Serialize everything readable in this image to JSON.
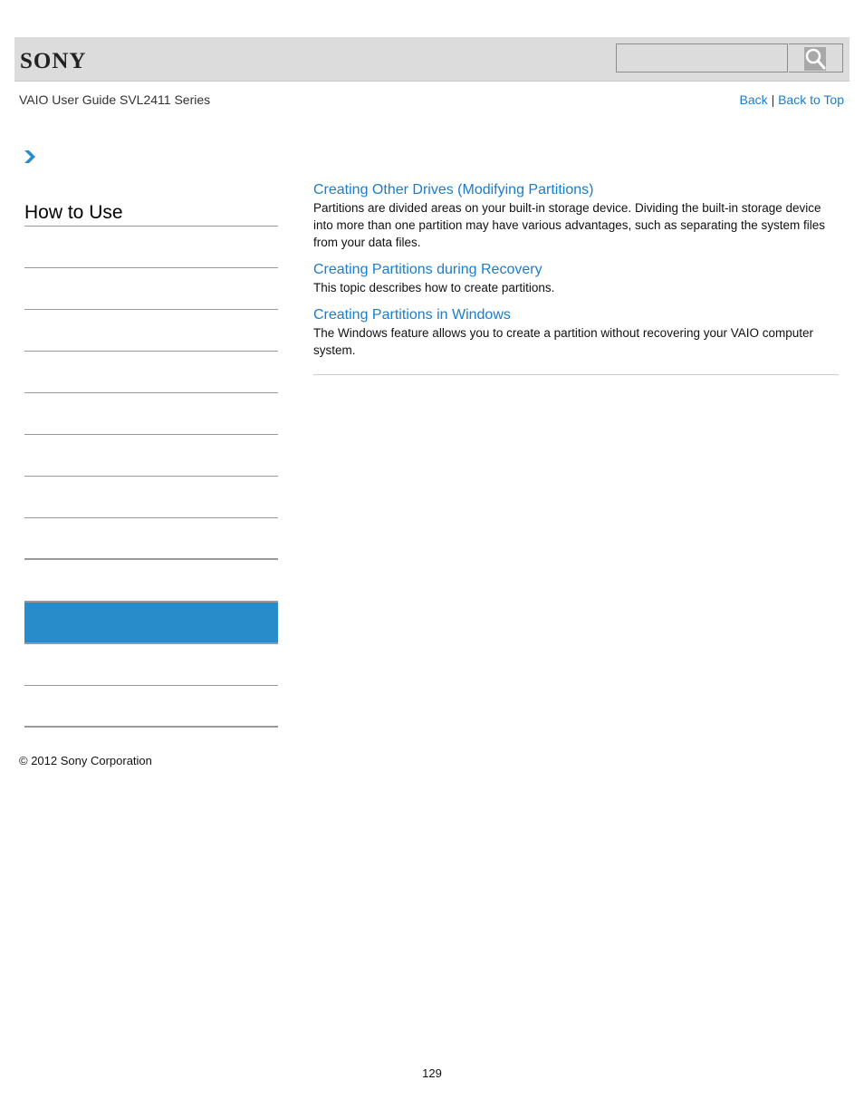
{
  "header": {
    "logo": "SONY",
    "search": {
      "placeholder": "",
      "value": ""
    },
    "search_button_icon": "search-icon"
  },
  "guide_title": "VAIO User Guide SVL2411 Series",
  "top_links": {
    "back": "Back",
    "separator": "|",
    "back_to_top": "Back to Top"
  },
  "breadcrumb_icon": "chevron-right-icon",
  "sidebar": {
    "title": "How to Use",
    "items": [
      {
        "label": "",
        "active": false
      },
      {
        "label": "",
        "active": false
      },
      {
        "label": "",
        "active": false
      },
      {
        "label": "",
        "active": false
      },
      {
        "label": "",
        "active": false
      },
      {
        "label": "",
        "active": false
      },
      {
        "label": "",
        "active": false
      },
      {
        "label": "",
        "active": false
      },
      {
        "label": "",
        "active": false
      },
      {
        "label": "",
        "active": true
      },
      {
        "label": "",
        "active": false
      },
      {
        "label": "",
        "active": false
      }
    ],
    "active_color": "#288ccb"
  },
  "topics": [
    {
      "title": "Creating Other Drives (Modifying Partitions)",
      "description": "Partitions are divided areas on your built-in storage device. Dividing the built-in storage device into more than one partition may have various advantages, such as separating the system files from your data files."
    },
    {
      "title": "Creating Partitions during Recovery",
      "description": "This topic describes how to create partitions."
    },
    {
      "title": "Creating Partitions in Windows",
      "description": "The Windows feature allows you to create a partition without recovering your VAIO computer system."
    }
  ],
  "footer": {
    "copyright": "© 2012 Sony Corporation",
    "page_number": "129"
  },
  "colors": {
    "link": "#1a7dcc",
    "header_bg": "#dcdcdc",
    "accent": "#288ccb"
  }
}
